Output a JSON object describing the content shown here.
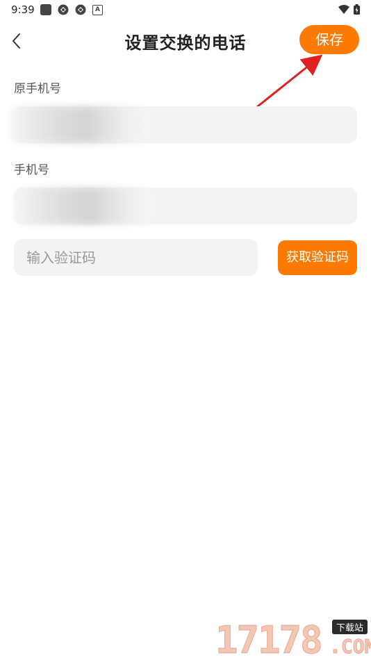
{
  "status": {
    "time": "9:39",
    "left_icons": [
      "square-notification-icon",
      "sync-icon",
      "sync-icon",
      "a-icon"
    ],
    "right_icons": [
      "wifi-icon",
      "battery-icon"
    ]
  },
  "header": {
    "title": "设置交换的电话",
    "save_label": "保存",
    "back_icon": "chevron-left-icon"
  },
  "form": {
    "old_phone_label": "原手机号",
    "old_phone_value": "",
    "new_phone_label": "手机号",
    "new_phone_value": "",
    "code_placeholder": "输入验证码",
    "code_value": "",
    "get_code_label": "获取验证码"
  },
  "annotation": {
    "arrow_color": "#e02020"
  },
  "watermark": {
    "digits": "17178",
    "badge": "下载站",
    "domain": ".COM"
  },
  "colors": {
    "accent": "#ff7a00",
    "input_bg": "#f3f3f3"
  }
}
